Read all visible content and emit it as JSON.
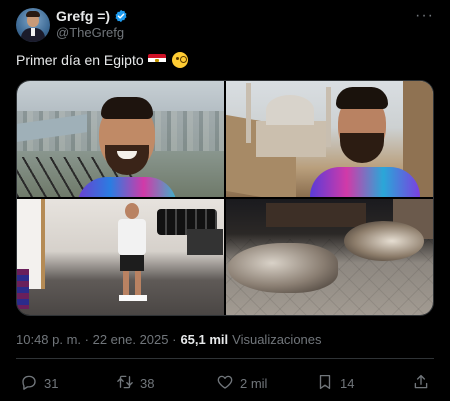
{
  "author": {
    "display_name": "Grefg =)",
    "handle": "@TheGrefg",
    "verified": true,
    "verified_color": "#1d9bf0"
  },
  "tweet": {
    "text": "Primer día en Egipto",
    "emoji": [
      "egypt-flag",
      "monocle-face"
    ]
  },
  "media": {
    "photos": [
      {
        "name": "photo-city-selfie"
      },
      {
        "name": "photo-mosque-selfie"
      },
      {
        "name": "photo-gym"
      },
      {
        "name": "photo-sleeping-dogs"
      }
    ]
  },
  "meta": {
    "timestamp": "10:48 p. m. · 22 ene. 2025 ·",
    "views_count": "65,1 mil",
    "views_label": "Visualizaciones"
  },
  "actions": {
    "replies": "31",
    "retweets": "38",
    "likes": "2 mil",
    "bookmarks": "14"
  },
  "colors": {
    "background": "#000000",
    "text_primary": "#e7e9ea",
    "text_secondary": "#71767b",
    "border": "#2f3336"
  }
}
